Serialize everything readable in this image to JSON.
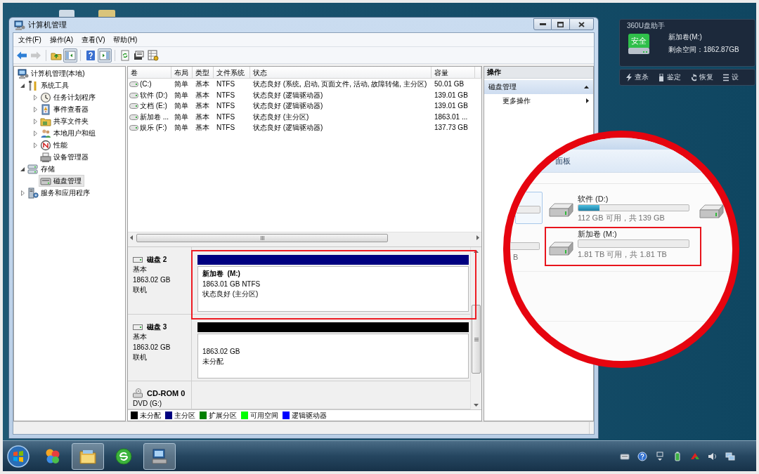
{
  "window": {
    "title": "计算机管理"
  },
  "menu": [
    "文件(F)",
    "操作(A)",
    "查看(V)",
    "帮助(H)"
  ],
  "toolbar": [
    {
      "pressed": false,
      "disabled": false
    },
    {
      "pressed": false,
      "disabled": true
    },
    {
      "pressed": false,
      "disabled": false
    },
    {
      "pressed": true,
      "disabled": false
    },
    {
      "pressed": false,
      "disabled": false
    },
    {
      "pressed": true,
      "disabled": false
    },
    {
      "pressed": false,
      "disabled": false
    },
    {
      "pressed": false,
      "disabled": false
    },
    {
      "pressed": false,
      "disabled": false
    }
  ],
  "tree": [
    {
      "label": "计算机管理(本地)",
      "selected": false,
      "children": [
        {
          "label": "系统工具",
          "expanded": true,
          "selected": false,
          "children": [
            {
              "label": "任务计划程序",
              "expanded": false,
              "selected": false
            },
            {
              "label": "事件查看器",
              "expanded": false,
              "selected": false
            },
            {
              "label": "共享文件夹",
              "expanded": false,
              "selected": false
            },
            {
              "label": "本地用户和组",
              "expanded": false,
              "selected": false
            },
            {
              "label": "性能",
              "expanded": false,
              "selected": false
            },
            {
              "label": "设备管理器",
              "selected": false
            }
          ]
        },
        {
          "label": "存储",
          "expanded": true,
          "selected": false,
          "children": [
            {
              "label": "磁盘管理",
              "selected": true
            }
          ]
        },
        {
          "label": "服务和应用程序",
          "expanded": false,
          "selected": false
        }
      ]
    }
  ],
  "volumes": {
    "columns": [
      "卷",
      "布局",
      "类型",
      "文件系统",
      "状态",
      "容量"
    ],
    "rows": [
      [
        "(C:)",
        "简单",
        "基本",
        "NTFS",
        "状态良好 (系统, 启动, 页面文件, 活动, 故障转储, 主分区)",
        "50.01 GB"
      ],
      [
        "软件 (D:)",
        "简单",
        "基本",
        "NTFS",
        "状态良好 (逻辑驱动器)",
        "139.01 GB"
      ],
      [
        "文档 (E:)",
        "简单",
        "基本",
        "NTFS",
        "状态良好 (逻辑驱动器)",
        "139.01 GB"
      ],
      [
        "新加卷 ...",
        "简单",
        "基本",
        "NTFS",
        "状态良好 (主分区)",
        "1863.01 ..."
      ],
      [
        "娱乐 (F:)",
        "简单",
        "基本",
        "NTFS",
        "状态良好 (逻辑驱动器)",
        "137.73 GB"
      ]
    ]
  },
  "disks": [
    {
      "kind": "disk",
      "name": "磁盘 2",
      "details": [
        "基本",
        "1863.02 GB",
        "联机"
      ],
      "highlighted": true,
      "partitions": [
        {
          "color": "#000080",
          "title": "新加卷  (M:)",
          "details": [
            "1863.01 GB NTFS",
            "状态良好 (主分区)"
          ]
        }
      ]
    },
    {
      "kind": "disk",
      "name": "磁盘 3",
      "details": [
        "基本",
        "1863.02 GB",
        "联机"
      ],
      "highlighted": false,
      "partitions": [
        {
          "color": "#000000",
          "details": [
            "1863.02 GB",
            "未分配"
          ]
        }
      ]
    },
    {
      "kind": "cdrom",
      "name": "CD-ROM 0",
      "details": [
        "DVD (G:)"
      ],
      "highlighted": false
    }
  ],
  "legend": [
    {
      "label": "未分配",
      "color": "#000000"
    },
    {
      "label": "主分区",
      "color": "#000080"
    },
    {
      "label": "扩展分区",
      "color": "#008000"
    },
    {
      "label": "可用空间",
      "color": "#00ff00"
    },
    {
      "label": "逻辑驱动器",
      "color": "#0000ff"
    }
  ],
  "actions": {
    "title": "操作",
    "section": {
      "label": "磁盘管理",
      "expanded": true
    },
    "items": [
      "更多操作"
    ]
  },
  "usb_helper": {
    "title": "360U盘助手",
    "badge": "安全",
    "drive": "新加卷(M:)",
    "free_space": "剩余空间：1862.87GB",
    "buttons": [
      "查杀",
      "鉴定",
      "恢复",
      "设"
    ]
  },
  "magnifier": {
    "breadcrumb": "面板",
    "left_caption": "B",
    "drives": [
      {
        "name": "软件 (D:)",
        "level": 0.19,
        "caption": "112 GB 可用，共 139 GB",
        "highlighted": false
      },
      {
        "name": "新加卷 (M:)",
        "level": 0,
        "caption": "1.81 TB 可用，共 1.81 TB",
        "highlighted": true
      }
    ]
  },
  "taskbar": {
    "buttons": [
      {
        "running": false
      },
      {
        "running": true
      },
      {
        "running": false
      },
      {
        "running": true
      }
    ]
  }
}
